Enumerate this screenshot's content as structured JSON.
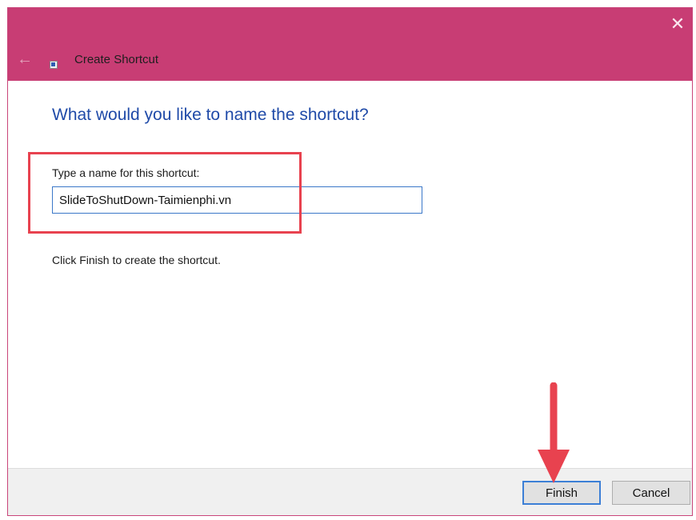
{
  "window": {
    "title": "Create Shortcut",
    "close_glyph": "✕",
    "back_glyph": "←",
    "accent_color": "#c83d74"
  },
  "content": {
    "heading": "What would you like to name the shortcut?",
    "name_label": "Type a name for this shortcut:",
    "name_value": "SlideToShutDown-Taimienphi.vn",
    "info": "Click Finish to create the shortcut."
  },
  "footer": {
    "finish_label": "Finish",
    "cancel_label": "Cancel"
  },
  "annotations": {
    "highlight_color": "#e8424f",
    "arrow_color": "#e8424f",
    "arrow_target": "finish-button"
  },
  "icons": [
    "shortcut-icon",
    "back-arrow-icon",
    "close-icon"
  ]
}
